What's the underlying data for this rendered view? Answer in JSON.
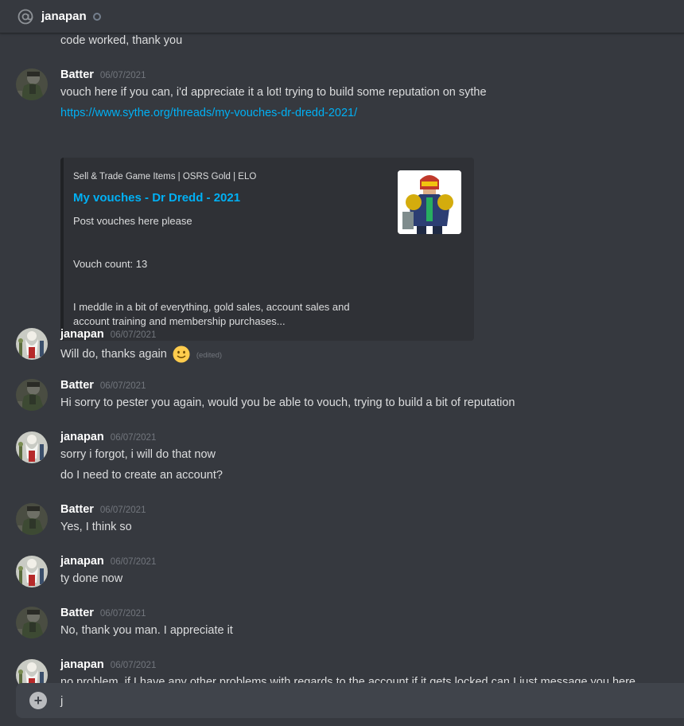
{
  "header": {
    "channel_name": "janapan",
    "icon": "at-sign-icon",
    "status_icon": "offline-status-icon"
  },
  "colors": {
    "background": "#36393f",
    "link": "#00b0f4",
    "timestamp": "#72767d",
    "embed_background": "#2f3136"
  },
  "messages": [
    {
      "text": "code worked, thank you"
    },
    {
      "author": "Batter",
      "timestamp": "06/07/2021",
      "lines": [
        "vouch here if you can, i'd appreciate it a lot! trying to build some reputation on sythe",
        "https://www.sythe.org/threads/my-vouches-dr-dredd-2021/"
      ],
      "embed": {
        "provider": "Sell & Trade Game Items | OSRS Gold | ELO",
        "title": "My vouches - Dr Dredd - 2021",
        "description": [
          "Post vouches here please",
          "Vouch count: 13",
          "I meddle in a bit of everything, gold sales, account sales and",
          "account training and membership purchases..."
        ],
        "thumbnail_icon": "judge-dredd-thumbnail"
      }
    },
    {
      "author": "janapan",
      "timestamp": "06/07/2021",
      "lines": [
        "Will do, thanks again"
      ],
      "emoji": "slight-smile-emoji",
      "edited_label": "(edited)"
    },
    {
      "author": "Batter",
      "timestamp": "06/07/2021",
      "lines": [
        "Hi sorry to pester you again, would you be able to vouch, trying to build a bit of reputation"
      ]
    },
    {
      "author": "janapan",
      "timestamp": "06/07/2021",
      "lines": [
        "sorry i forgot, i will do that now",
        "do I need to create an account?"
      ]
    },
    {
      "author": "Batter",
      "timestamp": "06/07/2021",
      "lines": [
        "Yes, I think so"
      ]
    },
    {
      "author": "janapan",
      "timestamp": "06/07/2021",
      "lines": [
        "ty done now"
      ]
    },
    {
      "author": "Batter",
      "timestamp": "06/07/2021",
      "lines": [
        "No, thank you man. I appreciate it"
      ]
    },
    {
      "author": "janapan",
      "timestamp": "06/07/2021",
      "lines": [
        "no problem, if I have any other problems with regards to the account if it gets locked can I just message you here"
      ]
    }
  ],
  "composer": {
    "value": "j",
    "attach_icon": "plus-circle-icon"
  }
}
